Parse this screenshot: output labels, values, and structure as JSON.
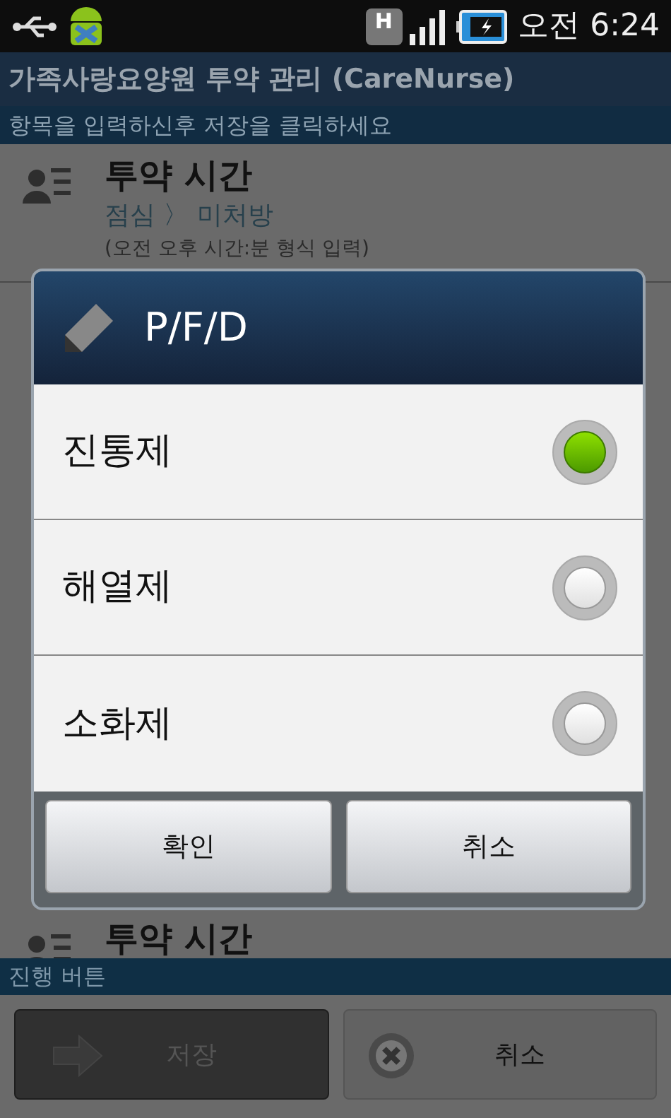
{
  "status_bar": {
    "network_badge": "H",
    "time": "오전 6:24"
  },
  "app_title": "가족사랑요양원 투약 관리 (CareNurse)",
  "instruction": "항목을 입력하신후 저장을 클릭하세요",
  "list_rows": [
    {
      "title": "투약 시간",
      "value": "점심 〉 미처방",
      "hint": "(오전 오후 시간:분 형식 입력)"
    },
    {
      "title": "투약 시간"
    }
  ],
  "dialog": {
    "title": "P/F/D",
    "options": [
      {
        "label": "진통제",
        "selected": true
      },
      {
        "label": "해열제",
        "selected": false
      },
      {
        "label": "소화제",
        "selected": false
      }
    ],
    "buttons": [
      "확인",
      "취소"
    ]
  },
  "section_label": "진행 버튼",
  "actions": [
    {
      "kind": "save",
      "label": "저장",
      "disabled": true
    },
    {
      "kind": "cancel",
      "label": "취소",
      "disabled": false
    }
  ]
}
